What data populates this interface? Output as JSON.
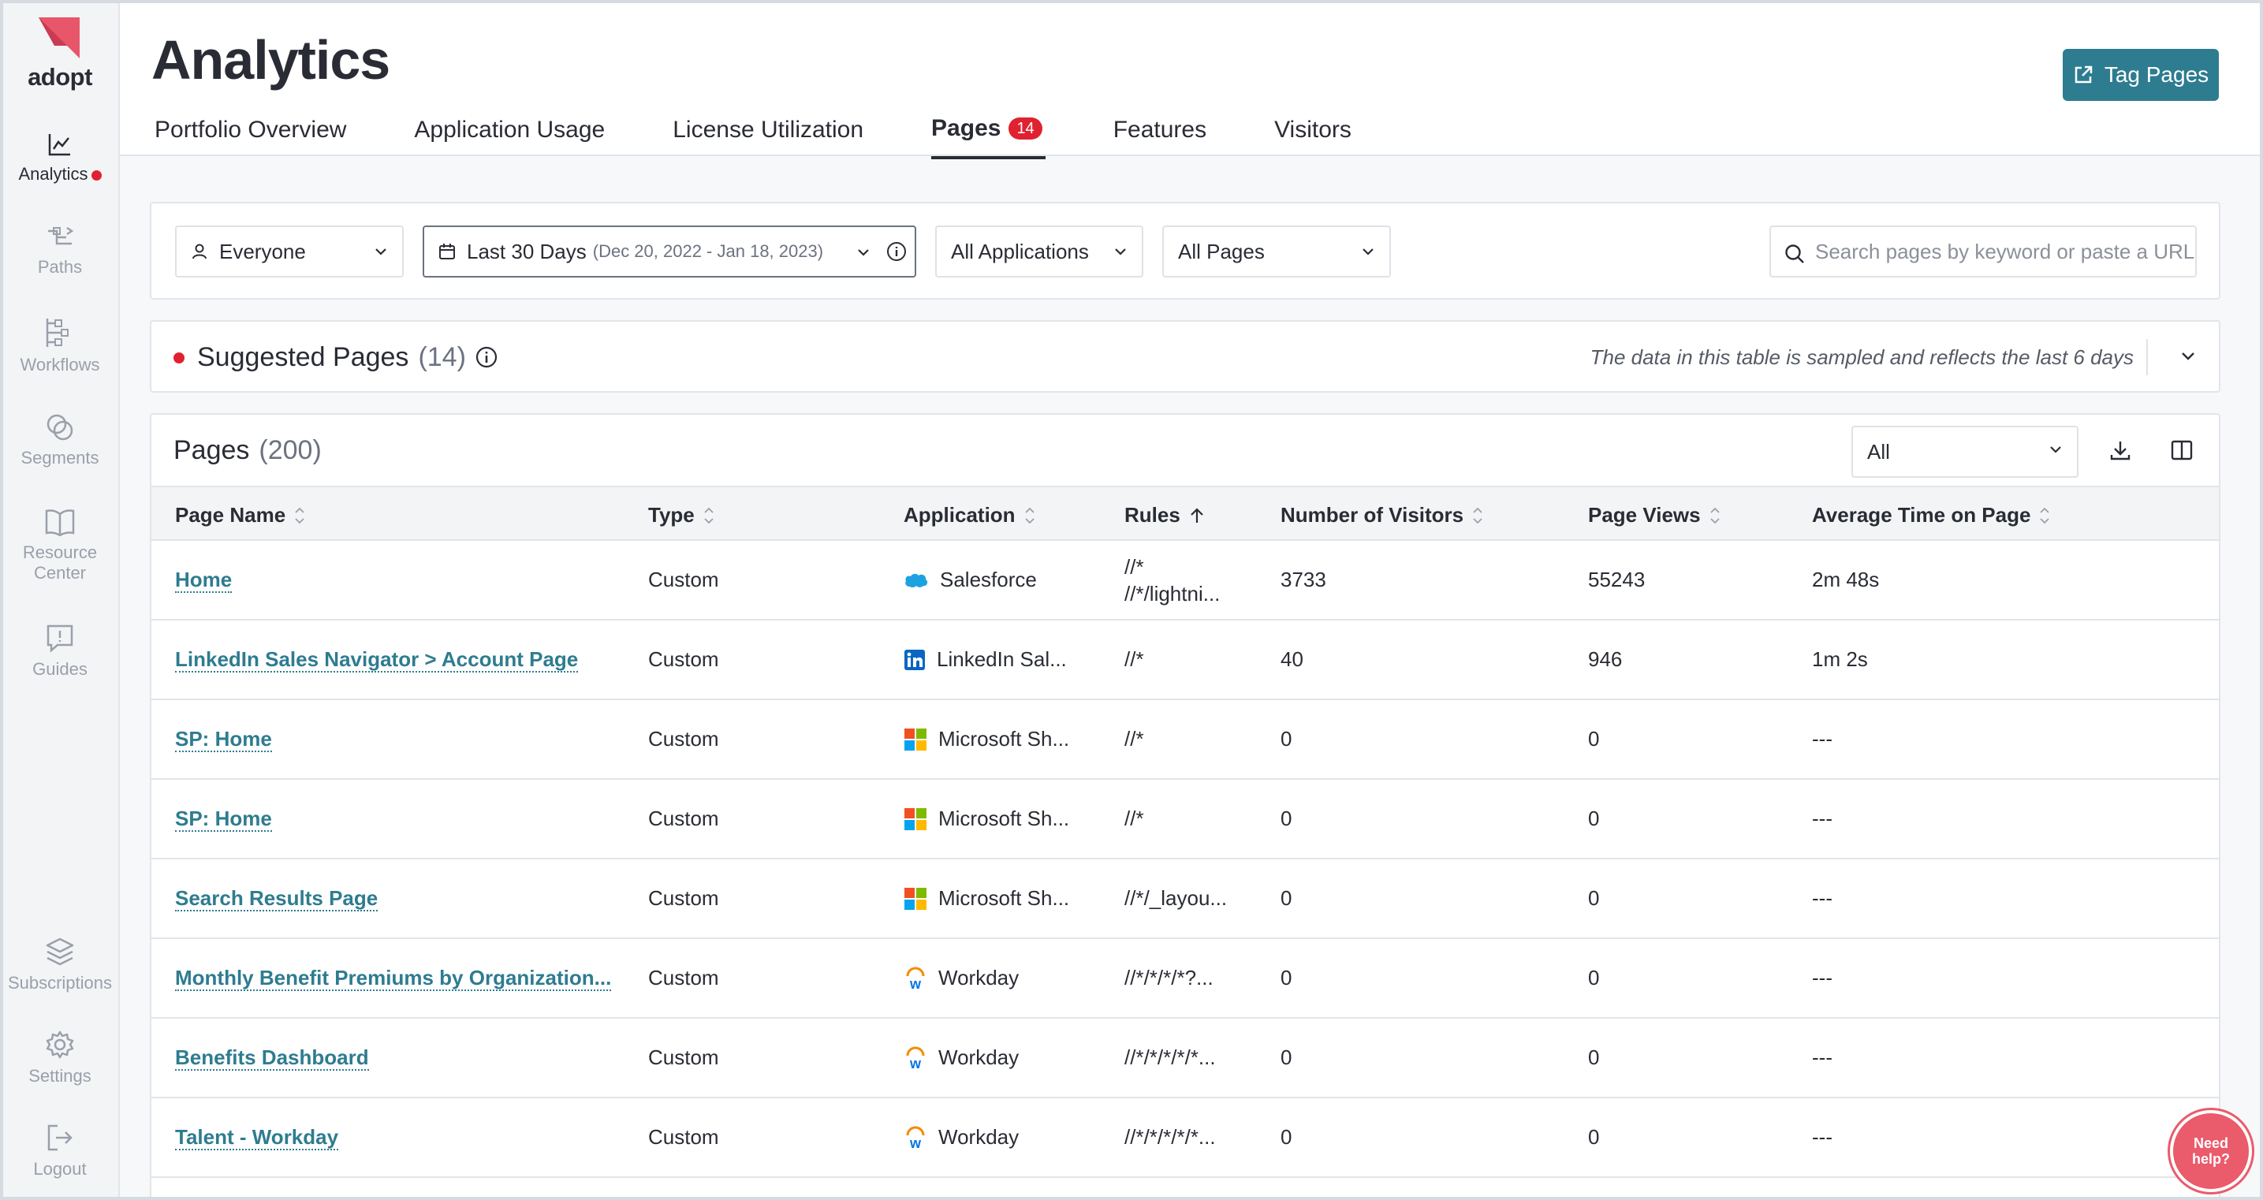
{
  "brand": {
    "name": "adopt",
    "logo_color": "#e8566a"
  },
  "sidebar": {
    "items": [
      {
        "label": "Analytics",
        "icon": "chart-line-icon",
        "active": true
      },
      {
        "label": "Paths",
        "icon": "paths-icon"
      },
      {
        "label": "Workflows",
        "icon": "workflows-icon"
      },
      {
        "label": "Segments",
        "icon": "segments-icon"
      },
      {
        "label": "Resource Center",
        "icon": "book-icon"
      },
      {
        "label": "Guides",
        "icon": "guides-icon"
      },
      {
        "label": "Subscriptions",
        "icon": "layers-icon"
      },
      {
        "label": "Settings",
        "icon": "gear-icon"
      },
      {
        "label": "Logout",
        "icon": "logout-icon"
      }
    ]
  },
  "header": {
    "title": "Analytics",
    "tag_button": "Tag Pages",
    "tabs": [
      {
        "label": "Portfolio Overview"
      },
      {
        "label": "Application Usage"
      },
      {
        "label": "License Utilization"
      },
      {
        "label": "Pages",
        "badge": "14",
        "active": true
      },
      {
        "label": "Features"
      },
      {
        "label": "Visitors"
      }
    ]
  },
  "filters": {
    "audience": "Everyone",
    "date_range": "Last 30 Days",
    "date_detail": "(Dec 20, 2022 - Jan 18, 2023)",
    "applications": "All Applications",
    "pages": "All Pages",
    "search_placeholder": "Search pages by keyword or paste a URL"
  },
  "suggested": {
    "title": "Suggested Pages",
    "count": "(14)",
    "note": "The data in this table is sampled and reflects the last 6 days"
  },
  "pages": {
    "title": "Pages",
    "count": "(200)",
    "filter_value": "All",
    "columns": [
      "Page Name",
      "Type",
      "Application",
      "Rules",
      "Number of Visitors",
      "Page Views",
      "Average Time on Page"
    ],
    "rows": [
      {
        "name": "Home",
        "type": "Custom",
        "app": "Salesforce",
        "app_icon": "salesforce-icon",
        "rules": [
          "//*",
          "//*/lightni..."
        ],
        "visitors": "3733",
        "views": "55243",
        "avg_time": "2m 48s"
      },
      {
        "name": "LinkedIn Sales Navigator > Account Page",
        "type": "Custom",
        "app": "LinkedIn Sal...",
        "app_icon": "linkedin-icon",
        "rules": [
          "//*"
        ],
        "visitors": "40",
        "views": "946",
        "avg_time": "1m 2s"
      },
      {
        "name": "SP: Home",
        "type": "Custom",
        "app": "Microsoft Sh...",
        "app_icon": "microsoft-icon",
        "rules": [
          "//*"
        ],
        "visitors": "0",
        "views": "0",
        "avg_time": "---"
      },
      {
        "name": "SP: Home",
        "type": "Custom",
        "app": "Microsoft Sh...",
        "app_icon": "microsoft-icon",
        "rules": [
          "//*"
        ],
        "visitors": "0",
        "views": "0",
        "avg_time": "---"
      },
      {
        "name": "Search Results Page",
        "type": "Custom",
        "app": "Microsoft Sh...",
        "app_icon": "microsoft-icon",
        "rules": [
          "//*/_layou..."
        ],
        "visitors": "0",
        "views": "0",
        "avg_time": "---"
      },
      {
        "name": "Monthly Benefit Premiums by Organization...",
        "type": "Custom",
        "app": "Workday",
        "app_icon": "workday-icon",
        "rules": [
          "//*/*/*/*?..."
        ],
        "visitors": "0",
        "views": "0",
        "avg_time": "---"
      },
      {
        "name": "Benefits Dashboard",
        "type": "Custom",
        "app": "Workday",
        "app_icon": "workday-icon",
        "rules": [
          "//*/*/*/*/*..."
        ],
        "visitors": "0",
        "views": "0",
        "avg_time": "---"
      },
      {
        "name": "Talent - Workday",
        "type": "Custom",
        "app": "Workday",
        "app_icon": "workday-icon",
        "rules": [
          "//*/*/*/*/*..."
        ],
        "visitors": "0",
        "views": "0",
        "avg_time": "---"
      }
    ]
  },
  "help_button": "Need help?",
  "colors": {
    "accent": "#2e7c90",
    "alert": "#e0212f",
    "brand": "#e8566a"
  }
}
